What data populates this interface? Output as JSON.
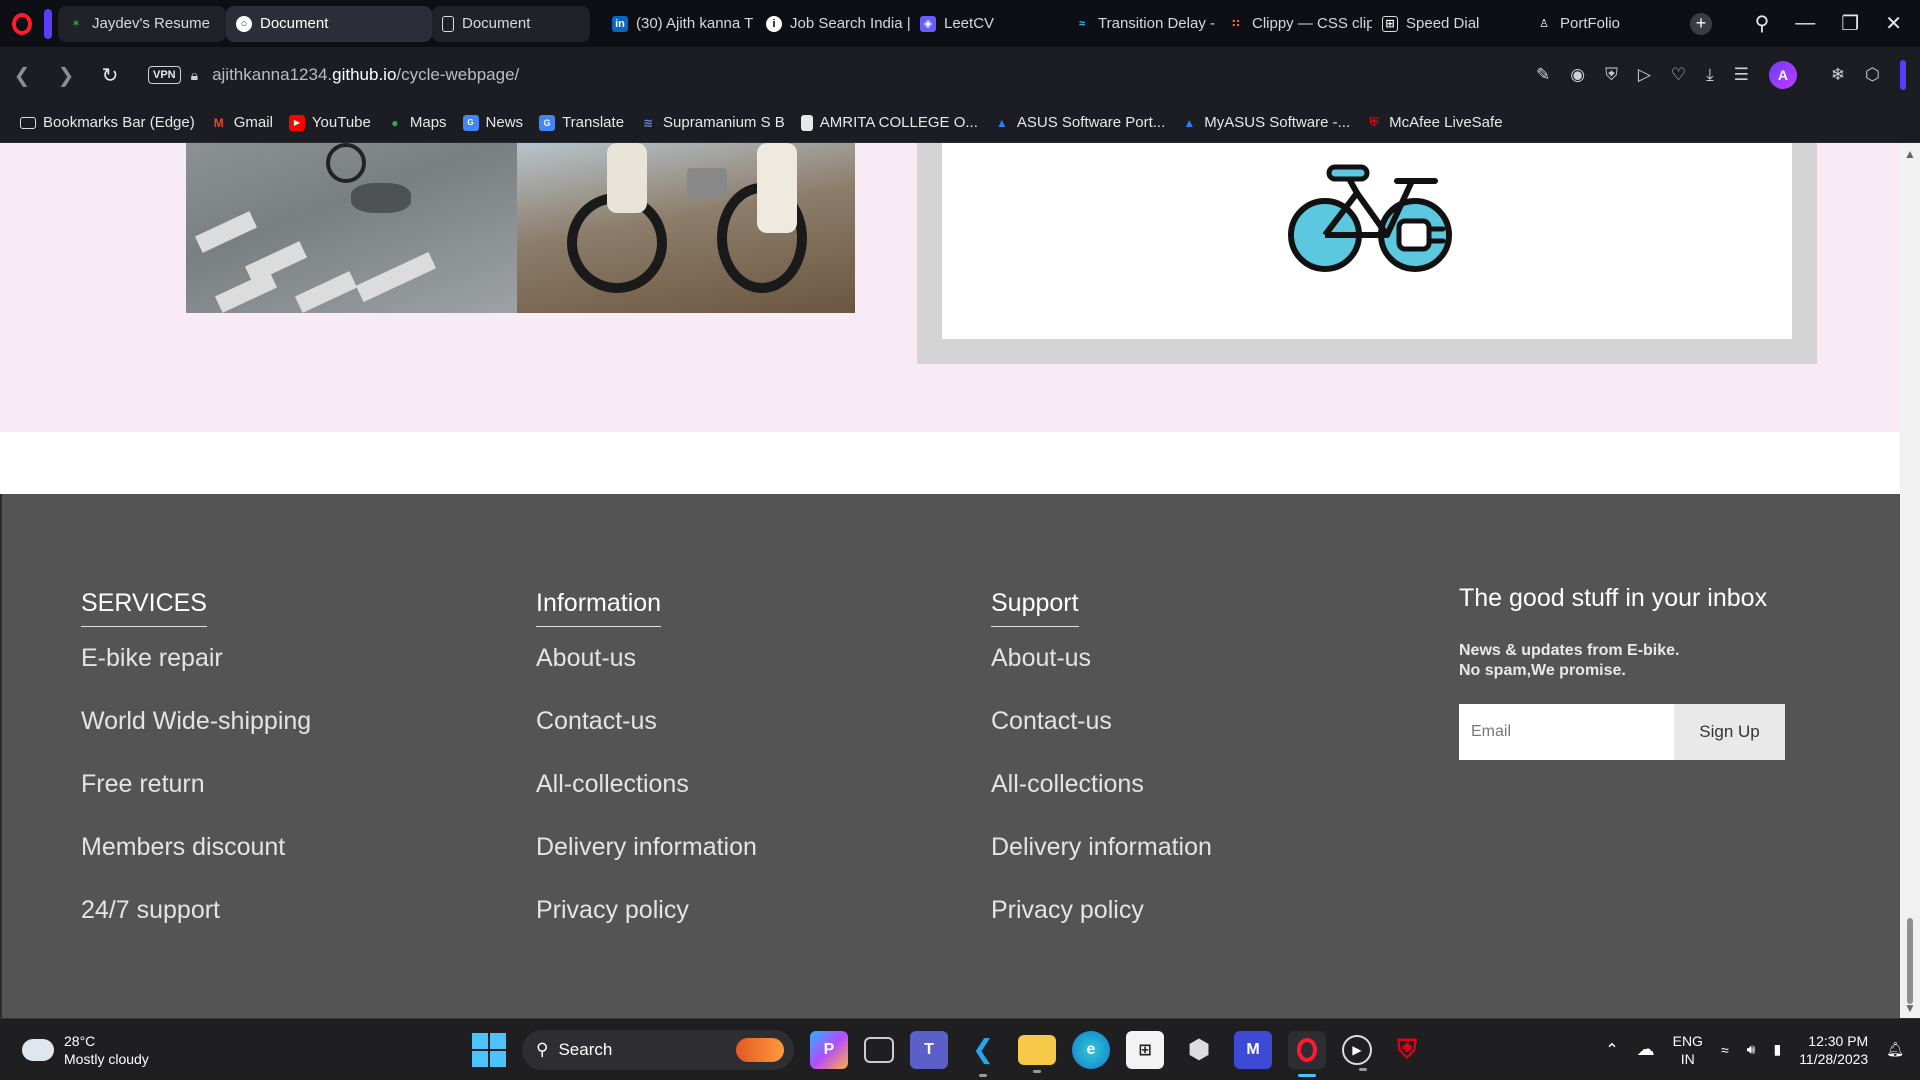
{
  "browser": {
    "tabs": [
      {
        "title": "Jaydev's Resume",
        "icon": "github-icon",
        "color": "#24b047"
      },
      {
        "title": "Document",
        "icon": "globe-icon",
        "color": "#ffffff",
        "active": true
      },
      {
        "title": "Document",
        "icon": "document-icon",
        "color": "#ffffff"
      },
      {
        "title": "(30) Ajith kanna T",
        "icon": "linkedin-icon",
        "color": "#0a66c2"
      },
      {
        "title": "Job Search India |",
        "icon": "info-icon",
        "color": "#ffffff"
      },
      {
        "title": "LeetCV",
        "icon": "leetcv-icon",
        "color": "#6b5cff"
      },
      {
        "title": "Transition Delay -",
        "icon": "tailwind-icon",
        "color": "#38bdf8"
      },
      {
        "title": "Clippy — CSS clip",
        "icon": "clippy-icon",
        "color": "#ff6d3a"
      },
      {
        "title": "Speed Dial",
        "icon": "speed-dial-icon",
        "color": "#ffffff"
      },
      {
        "title": "PortFolio",
        "icon": "person-icon",
        "color": "#ffffff"
      }
    ],
    "url_prefix": "ajithkanna1234.",
    "url_domain": "github.io",
    "url_path": "/cycle-webpage/",
    "vpn_label": "VPN",
    "bookmarks": [
      {
        "label": "Bookmarks Bar (Edge)",
        "icon": "folder-icon"
      },
      {
        "label": "Gmail",
        "icon": "gmail-icon"
      },
      {
        "label": "YouTube",
        "icon": "youtube-icon"
      },
      {
        "label": "Maps",
        "icon": "maps-icon"
      },
      {
        "label": "News",
        "icon": "news-icon"
      },
      {
        "label": "Translate",
        "icon": "translate-icon"
      },
      {
        "label": "Supramanium S B",
        "icon": "link-icon"
      },
      {
        "label": "AMRITA COLLEGE O...",
        "icon": "document-icon"
      },
      {
        "label": "ASUS Software Port...",
        "icon": "asus-icon"
      },
      {
        "label": "MyASUS Software -...",
        "icon": "asus-icon"
      },
      {
        "label": "McAfee LiveSafe",
        "icon": "mcafee-icon"
      }
    ]
  },
  "page": {
    "footer": {
      "columns": [
        {
          "heading": "SERVICES",
          "links": [
            "E-bike repair",
            "World Wide-shipping",
            "Free return",
            "Members discount",
            "24/7 support"
          ]
        },
        {
          "heading": "Information",
          "links": [
            "About-us",
            "Contact-us",
            "All-collections",
            "Delivery information",
            "Privacy policy"
          ]
        },
        {
          "heading": "Support",
          "links": [
            "About-us",
            "Contact-us",
            "All-collections",
            "Delivery information",
            "Privacy policy"
          ]
        }
      ],
      "newsletter": {
        "heading": "The good stuff in your inbox",
        "line1": "News & updates from E-bike.",
        "line2": "No spam,We promise.",
        "email_placeholder": "Email",
        "signup_label": "Sign Up"
      }
    },
    "colors": {
      "pink_bg": "#f9ebf5",
      "footer_bg": "#545454",
      "bike_accent": "#5bc8e0"
    }
  },
  "taskbar": {
    "weather_temp": "28°C",
    "weather_desc": "Mostly cloudy",
    "search_label": "Search",
    "lang_line1": "ENG",
    "lang_line2": "IN",
    "time": "12:30 PM",
    "date": "11/28/2023"
  }
}
